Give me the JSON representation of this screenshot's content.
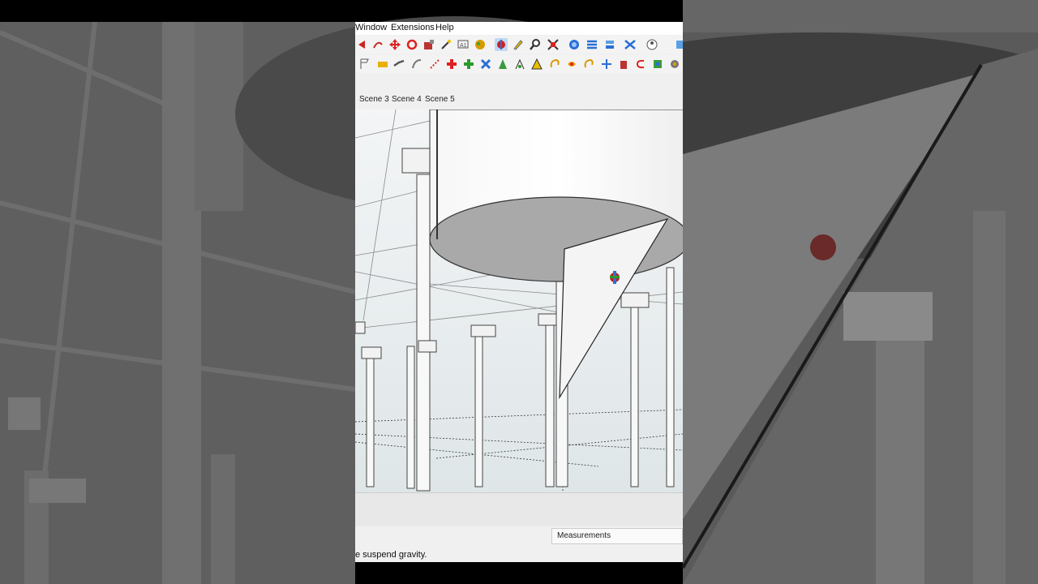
{
  "menu": {
    "window": "Window",
    "extensions": "Extensions",
    "help": "Help"
  },
  "toolbar_top_icons": [
    "orbit-icon",
    "pan-icon",
    "move-icon",
    "rotate-icon",
    "paint-bucket-icon",
    "tape-measure-icon",
    "text-icon",
    "sandbox-icon",
    "walk-icon",
    "look-around-icon",
    "zoom-icon",
    "zoom-extents-icon",
    "section-plane-icon",
    "layers-icon",
    "styles-icon",
    "account-icon",
    "warehouse-icon"
  ],
  "toolbar_bottom_icons": [
    "select-icon",
    "eraser-icon",
    "line-icon",
    "arc-icon",
    "push-pull-icon",
    "offset-icon",
    "scale-icon",
    "follow-me-icon",
    "dimension-icon",
    "protractor-icon",
    "axes-icon",
    "3d-text-icon",
    "undo-icon",
    "redo-icon",
    "component-icon",
    "extension-icon"
  ],
  "scenes": {
    "tabs": [
      "Scene 3",
      "Scene 4",
      "Scene 5"
    ]
  },
  "measurements": {
    "label": "Measurements"
  },
  "status": {
    "text": "e suspend gravity."
  },
  "colors": {
    "accent_blue": "#1f6fd6",
    "accent_red": "#d02020",
    "background": "#000000"
  }
}
